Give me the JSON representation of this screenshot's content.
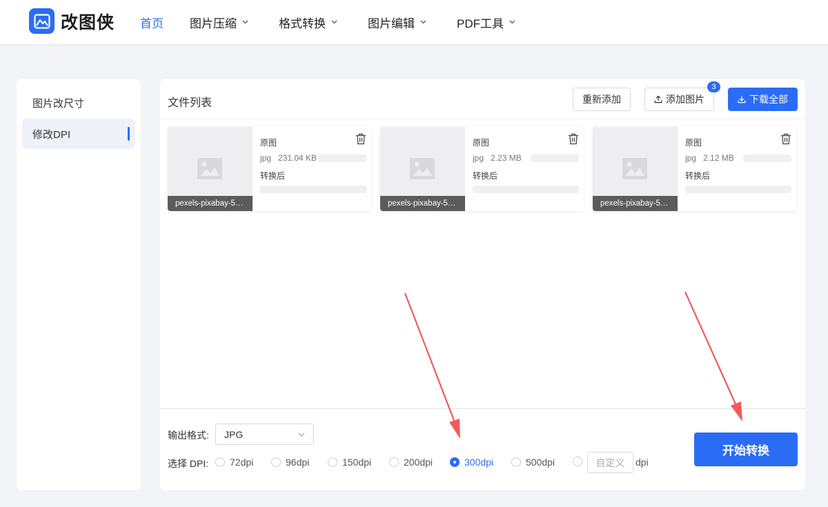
{
  "app": {
    "name": "改图侠",
    "accent": "#2a6df4"
  },
  "nav": {
    "items": [
      {
        "label": "首页",
        "active": true
      },
      {
        "label": "图片压缩"
      },
      {
        "label": "格式转换"
      },
      {
        "label": "图片编辑"
      },
      {
        "label": "PDF工具"
      }
    ]
  },
  "sidebar": {
    "items": [
      {
        "label": "图片改尺寸"
      },
      {
        "label": "修改DPI",
        "active": true
      }
    ]
  },
  "toolbar": {
    "title": "文件列表",
    "readd_label": "重新添加",
    "add_label": "添加图片",
    "add_badge": "3",
    "download_label": "下载全部"
  },
  "files": [
    {
      "name": "pexels-pixabay-5…",
      "ext": "jpg",
      "size": "231.04 KB",
      "orig_label": "原图",
      "after_label": "转换后"
    },
    {
      "name": "pexels-pixabay-5…",
      "ext": "jpg",
      "size": "2.23 MB",
      "orig_label": "原图",
      "after_label": "转换后"
    },
    {
      "name": "pexels-pixabay-5…",
      "ext": "jpg",
      "size": "2.12 MB",
      "orig_label": "原图",
      "after_label": "转换后"
    }
  ],
  "settings": {
    "format_label": "输出格式:",
    "format_value": "JPG",
    "dpi_label": "选择 DPI:",
    "dpi_options": [
      "72dpi",
      "96dpi",
      "150dpi",
      "200dpi",
      "300dpi",
      "500dpi"
    ],
    "dpi_selected": "300dpi",
    "custom_placeholder": "自定义",
    "dpi_unit": "dpi"
  },
  "start_label": "开始转换",
  "annotation_color": "#f25a5a"
}
